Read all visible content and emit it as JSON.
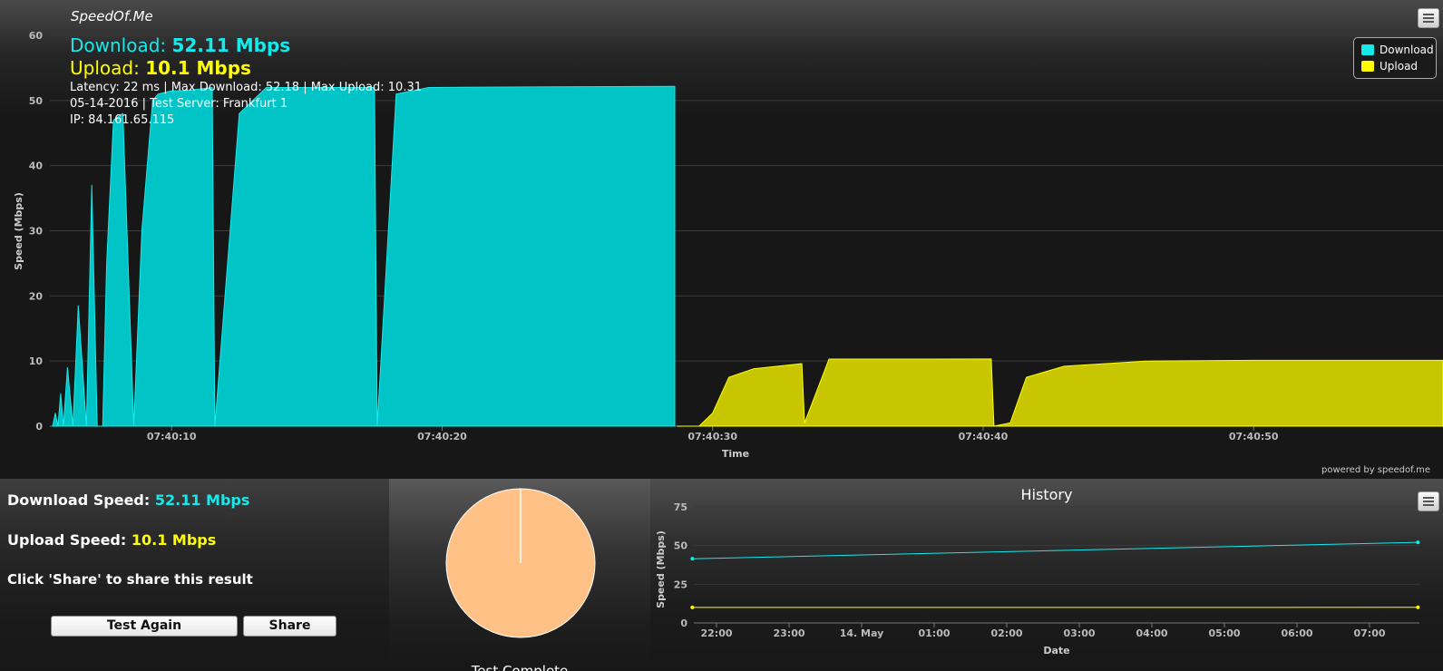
{
  "brand": "SpeedOf.Me",
  "summary": {
    "download_label": "Download:",
    "download_value": "52.11 Mbps",
    "upload_label": "Upload:",
    "upload_value": "10.1 Mbps",
    "latency_line": "Latency: 22 ms | Max Download: 52.18 | Max Upload: 10.31",
    "date_line": "05-14-2016 | Test Server: Frankfurt 1",
    "ip_line": "IP: 84.161.65.115"
  },
  "powered_by": "powered by speedof.me",
  "info": {
    "download_label": "Download Speed:",
    "download_value": "52.11 Mbps",
    "upload_label": "Upload Speed:",
    "upload_value": "10.1 Mbps",
    "share_hint": "Click 'Share' to share this result",
    "test_again_label": "Test Again",
    "share_label": "Share"
  },
  "pie": {
    "status_label": "Test Complete",
    "fill_color": "#ffc185",
    "progress": 1.0
  },
  "history_title": "History",
  "colors": {
    "download": "#16e9ec",
    "download_area": "#00c4c6",
    "upload": "#ffff00",
    "upload_area": "#c7c600",
    "background": "#171717"
  },
  "icons": {
    "menu": "hamburger-icon"
  },
  "chart_data": [
    {
      "type": "area",
      "xlabel": "Time",
      "ylabel": "Speed (Mbps)",
      "ylim": [
        0,
        60
      ],
      "yticks": [
        0,
        10,
        20,
        30,
        40,
        50,
        60
      ],
      "xlim": [
        "07:40:05.5",
        "07:40:57"
      ],
      "xticks": [
        "07:40:10",
        "07:40:20",
        "07:40:30",
        "07:40:40",
        "07:40:50"
      ],
      "grid": true,
      "legend_position": "top-right",
      "series": [
        {
          "name": "Download",
          "x": [
            "07:40:05.6",
            "07:40:05.7",
            "07:40:05.8",
            "07:40:05.9",
            "07:40:06.0",
            "07:40:06.15",
            "07:40:06.35",
            "07:40:06.55",
            "07:40:06.85",
            "07:40:07.05",
            "07:40:07.25",
            "07:40:07.45",
            "07:40:07.6",
            "07:40:07.85",
            "07:40:08.2",
            "07:40:08.6",
            "07:40:08.9",
            "07:40:09.3",
            "07:40:09.5",
            "07:40:10.0",
            "07:40:10.5",
            "07:40:11.5",
            "07:40:11.6",
            "07:40:12.5",
            "07:40:13.5",
            "07:40:17.5",
            "07:40:17.6",
            "07:40:18.3",
            "07:40:19.5",
            "07:40:24.0",
            "07:40:28.6"
          ],
          "y": [
            0,
            2,
            0,
            5,
            0,
            9,
            0,
            18.5,
            0,
            37,
            0,
            0,
            25,
            47,
            48,
            0,
            30,
            50,
            51,
            51.5,
            51.5,
            52,
            0,
            48,
            52,
            52,
            0,
            51,
            52,
            52.1,
            52.18
          ]
        },
        {
          "name": "Upload",
          "x": [
            "07:40:28.7",
            "07:40:29.5",
            "07:40:30.0",
            "07:40:30.6",
            "07:40:31.5",
            "07:40:33.3",
            "07:40:33.4",
            "07:40:34.3",
            "07:40:36.0",
            "07:40:40.3",
            "07:40:40.4",
            "07:40:41.0",
            "07:40:41.6",
            "07:40:43.0",
            "07:40:46.0",
            "07:40:50.0",
            "07:40:57.0"
          ],
          "y": [
            0,
            0,
            2,
            7.5,
            8.8,
            9.6,
            0.5,
            10.3,
            10.3,
            10.31,
            0,
            0.5,
            7.5,
            9.2,
            10,
            10.1,
            10.1
          ]
        }
      ]
    },
    {
      "type": "line",
      "title": "History",
      "xlabel": "Date",
      "ylabel": "Speed (Mbps)",
      "ylim": [
        0,
        75
      ],
      "yticks": [
        0,
        25,
        50,
        75
      ],
      "xticks": [
        "22:00",
        "23:00",
        "14. May",
        "01:00",
        "02:00",
        "03:00",
        "04:00",
        "05:00",
        "06:00",
        "07:00"
      ],
      "grid": true,
      "series": [
        {
          "name": "Download",
          "x": [
            "2016-05-13 21:40",
            "2016-05-14 07:40"
          ],
          "y": [
            41.5,
            52.11
          ]
        },
        {
          "name": "Upload",
          "x": [
            "2016-05-13 21:40",
            "2016-05-14 07:40"
          ],
          "y": [
            10.0,
            10.1
          ]
        }
      ]
    }
  ]
}
